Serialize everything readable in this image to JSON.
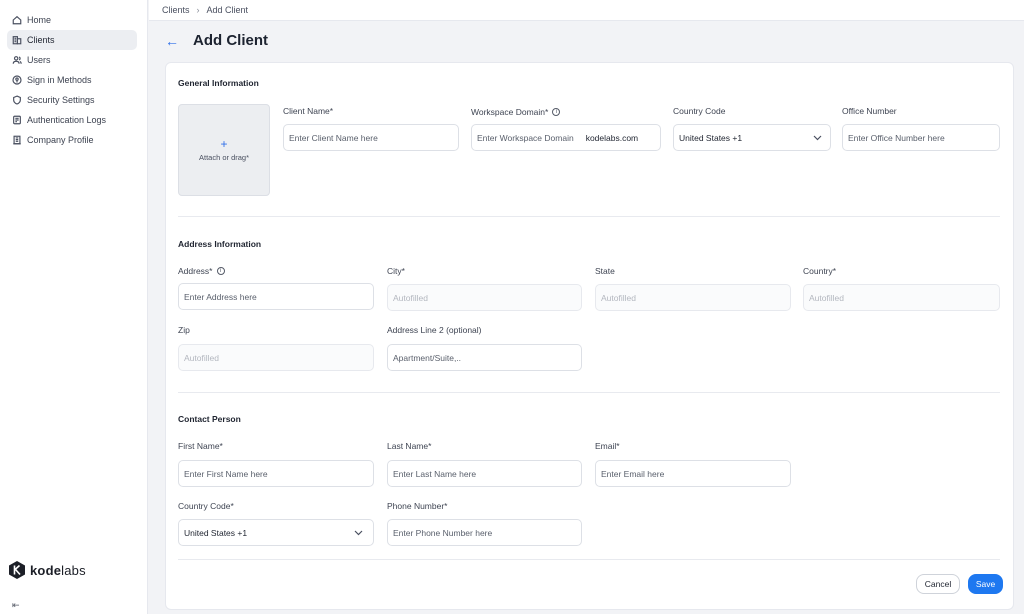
{
  "sidebar": {
    "items": [
      {
        "label": "Home",
        "icon": "home-icon",
        "active": false
      },
      {
        "label": "Clients",
        "icon": "building-icon",
        "active": true
      },
      {
        "label": "Users",
        "icon": "users-icon",
        "active": false
      },
      {
        "label": "Sign in Methods",
        "icon": "key-circle-icon",
        "active": false
      },
      {
        "label": "Security Settings",
        "icon": "shield-icon",
        "active": false
      },
      {
        "label": "Authentication Logs",
        "icon": "log-icon",
        "active": false
      },
      {
        "label": "Company Profile",
        "icon": "company-icon",
        "active": false
      }
    ],
    "brand_bold": "kode",
    "brand_light": "labs",
    "collapse_glyph": "⇤"
  },
  "breadcrumb": {
    "parent": "Clients",
    "current": "Add Client"
  },
  "page": {
    "title": "Add Client"
  },
  "general": {
    "title": "General Information",
    "upload_label": "Attach or drag*",
    "client_name": {
      "label": "Client Name*",
      "placeholder": "Enter Client Name here"
    },
    "workspace_domain": {
      "label": "Workspace Domain*",
      "placeholder": "Enter Workspace Domain",
      "suffix": "kodelabs.com"
    },
    "country_code": {
      "label": "Country Code",
      "value": "United States +1"
    },
    "office_number": {
      "label": "Office Number",
      "placeholder": "Enter Office Number here"
    }
  },
  "address": {
    "title": "Address Information",
    "address": {
      "label": "Address*",
      "placeholder": "Enter Address here"
    },
    "city": {
      "label": "City*",
      "placeholder": "Autofilled"
    },
    "state": {
      "label": "State",
      "placeholder": "Autofilled"
    },
    "country": {
      "label": "Country*",
      "placeholder": "Autofilled"
    },
    "zip": {
      "label": "Zip",
      "placeholder": "Autofilled"
    },
    "address_line2": {
      "label": "Address Line 2 (optional)",
      "placeholder": "Apartment/Suite,.."
    }
  },
  "contact": {
    "title": "Contact Person",
    "first_name": {
      "label": "First Name*",
      "placeholder": "Enter First Name here"
    },
    "last_name": {
      "label": "Last Name*",
      "placeholder": "Enter Last Name here"
    },
    "email": {
      "label": "Email*",
      "placeholder": "Enter Email here"
    },
    "country_code": {
      "label": "Country Code*",
      "value": "United States +1"
    },
    "phone": {
      "label": "Phone Number*",
      "placeholder": "Enter Phone Number here"
    }
  },
  "actions": {
    "cancel": "Cancel",
    "save": "Save"
  },
  "colors": {
    "accent": "#1e78f0",
    "background": "#f2f3f6"
  }
}
